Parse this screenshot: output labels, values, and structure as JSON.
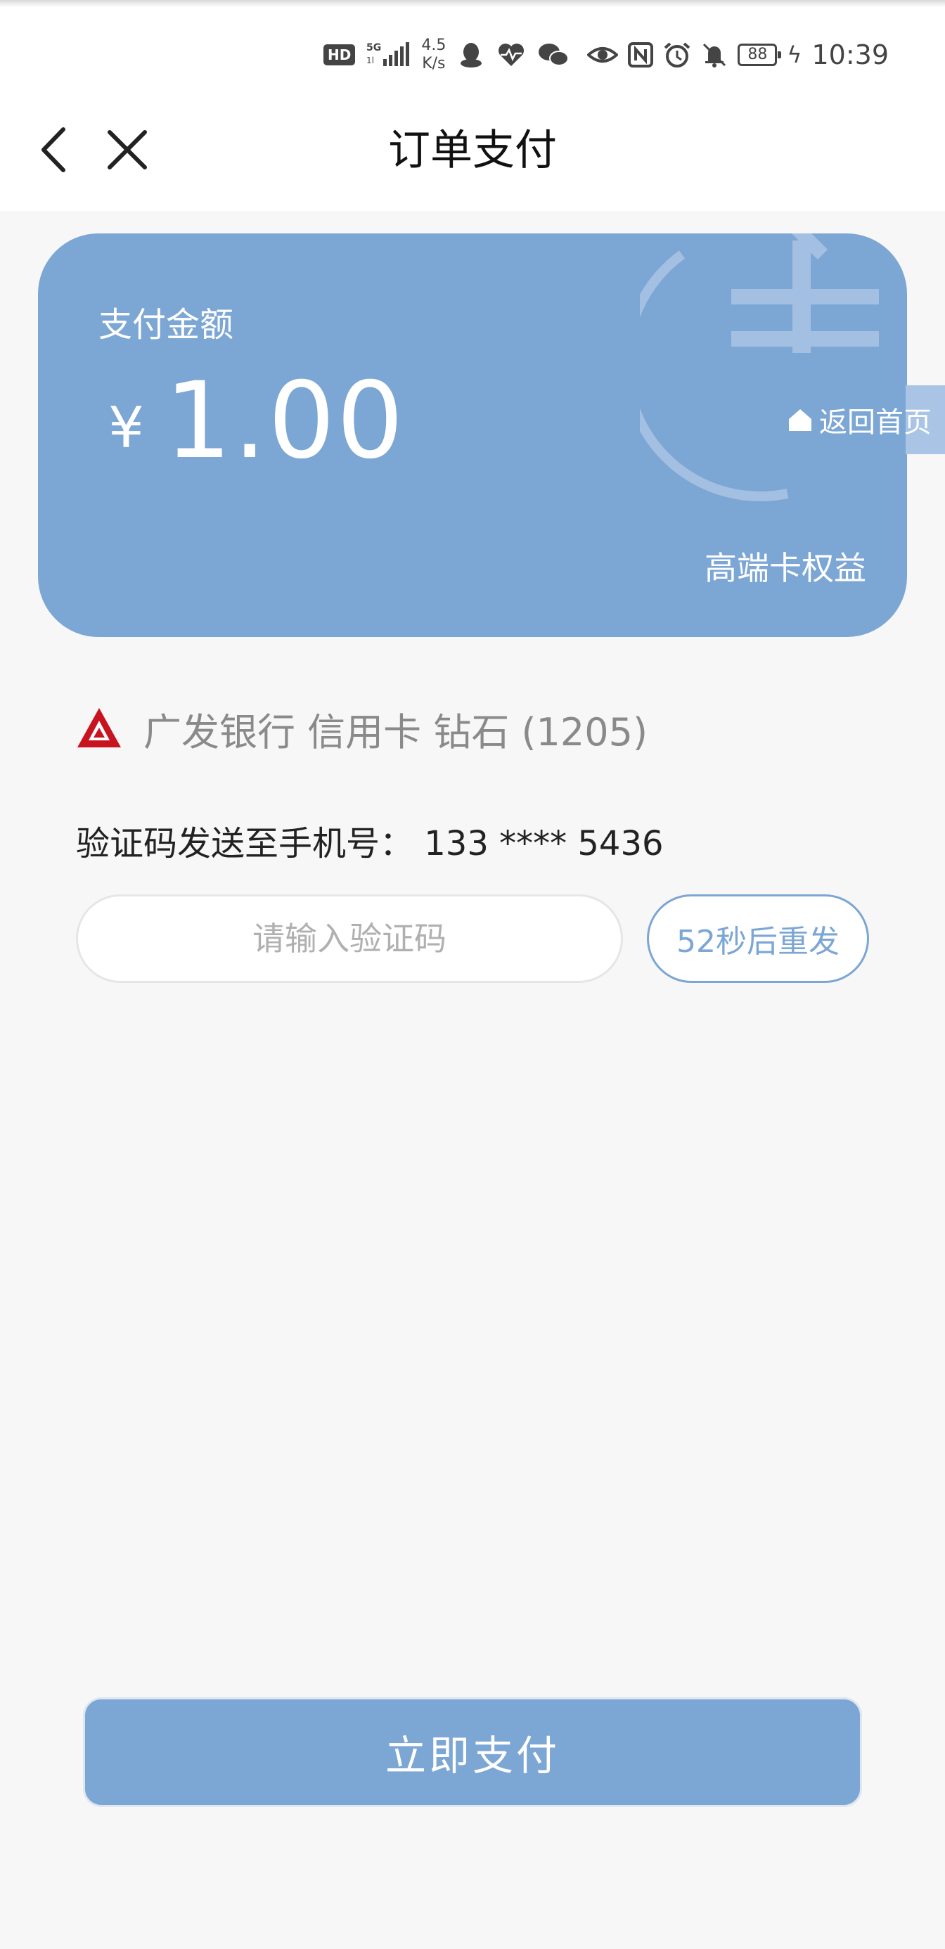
{
  "status_bar": {
    "hd": "HD",
    "network": "5G",
    "speed_value": "4.5",
    "speed_unit": "K/s",
    "battery": "88",
    "time": "10:39",
    "icons": [
      "qq-icon",
      "heart-rate-icon",
      "wechat-icon",
      "eye-icon",
      "nfc-icon",
      "alarm-icon",
      "mute-icon",
      "battery-icon",
      "charging-icon"
    ]
  },
  "nav": {
    "title": "订单支付",
    "back_icon": "chevron-left-icon",
    "close_icon": "close-icon"
  },
  "card": {
    "label": "支付金额",
    "currency": "¥",
    "amount": "1.00",
    "benefit": "高端卡权益",
    "home": "返回首页",
    "color": "#7ca6d4"
  },
  "bank": {
    "text": "广发银行 信用卡 钻石 (1205)",
    "logo_color": "#c8141e"
  },
  "verify": {
    "hint": "验证码发送至手机号：  133 **** 5436",
    "placeholder": "请输入验证码",
    "resend": "52秒后重发"
  },
  "pay": {
    "label": "立即支付"
  }
}
